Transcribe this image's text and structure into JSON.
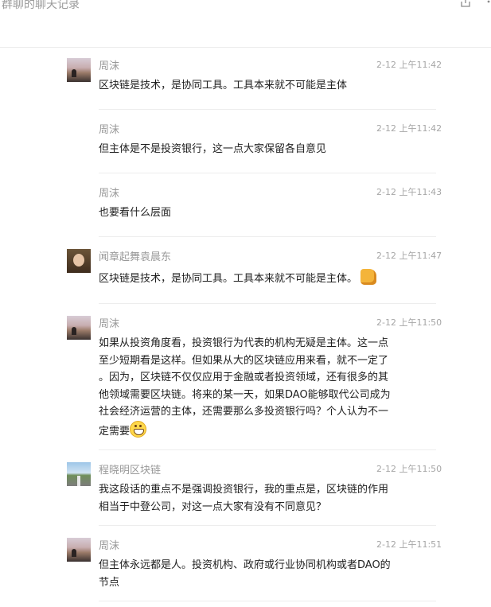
{
  "header": {
    "title": "群聊的聊天记录",
    "share_icon": "share-icon",
    "more_icon": "more-icon"
  },
  "messages": [
    {
      "sender": "周沫",
      "time": "2-12 上午11:42",
      "text": "区块链是技术，是协同工具。工具本来就不可能是主体",
      "avatar": "dusk-landscape"
    },
    {
      "sender": "周沫",
      "time": "2-12 上午11:42",
      "text": "但主体是不是投资银行，这一点大家保留各自意见"
    },
    {
      "sender": "周沫",
      "time": "2-12 上午11:43",
      "text": "也要看什么层面"
    },
    {
      "sender": "闻章起舞袁晨东",
      "time": "2-12 上午11:47",
      "text": "区块链是技术，是协同工具。工具本来就不可能是主体。",
      "emoji": "thumbs-up-emoji",
      "avatar": "person-photo"
    },
    {
      "sender": "周沫",
      "time": "2-12 上午11:50",
      "text_lines": [
        "如果从投资角度看，投资银行为代表的机构无疑是主体。这一点",
        "至少短期看是这样。但如果从大的区块链应用来看，就不一定了",
        "。因为，区块链不仅仅应用于金融或者投资领域，还有很多的其",
        "他领域需要区块链。将来的某一天，如果DAO能够取代公司成为",
        "社会经济运营的主体，还需要那么多投资银行吗？个人认为不一",
        "定需要"
      ],
      "emoji": "grin-emoji",
      "avatar": "dusk-landscape"
    },
    {
      "sender": "程晓明区块链",
      "time": "2-12 上午11:50",
      "text_lines": [
        "我这段话的重点不是强调投资银行，我的重点是，区块链的作用",
        "相当于中登公司，对这一点大家有没有不同意见？"
      ],
      "avatar": "road-landscape"
    },
    {
      "sender": "周沫",
      "time": "2-12 上午11:51",
      "text_lines": [
        "但主体永远都是人。投资机构、政府或行业协同机构或者DAO的",
        "节点"
      ],
      "avatar": "dusk-landscape"
    }
  ]
}
